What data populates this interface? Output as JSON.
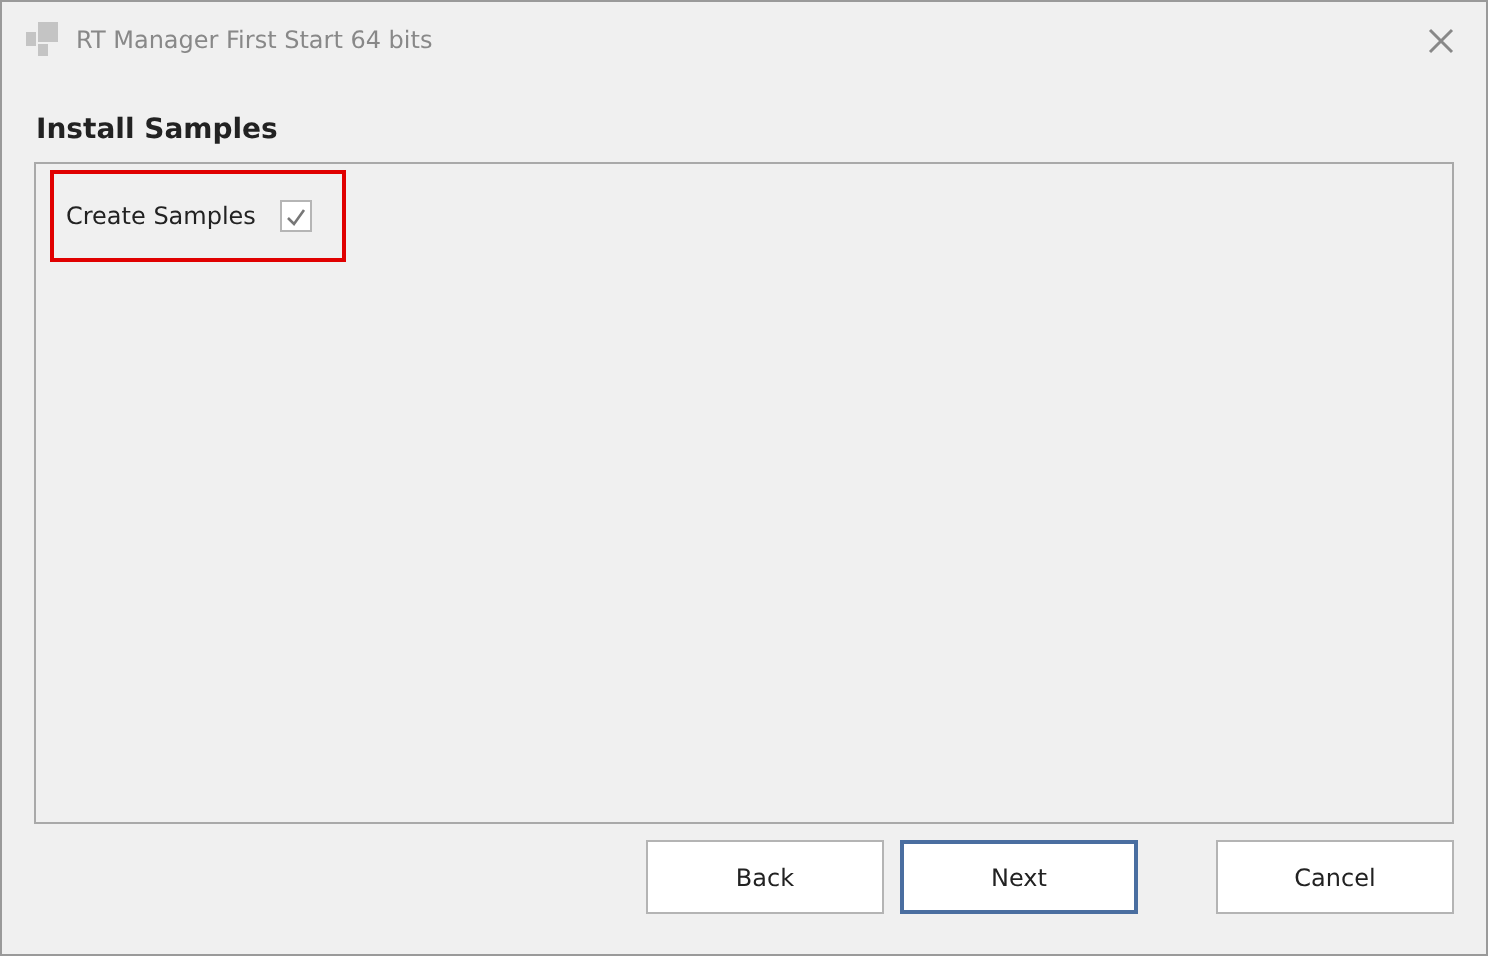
{
  "window": {
    "title": "RT Manager First Start 64 bits"
  },
  "heading": "Install Samples",
  "option": {
    "label": "Create Samples",
    "checked": true,
    "highlighted": true
  },
  "buttons": [
    {
      "label": "Back",
      "default": false
    },
    {
      "label": "Next",
      "default": true
    },
    {
      "label": "Cancel",
      "default": false
    }
  ]
}
